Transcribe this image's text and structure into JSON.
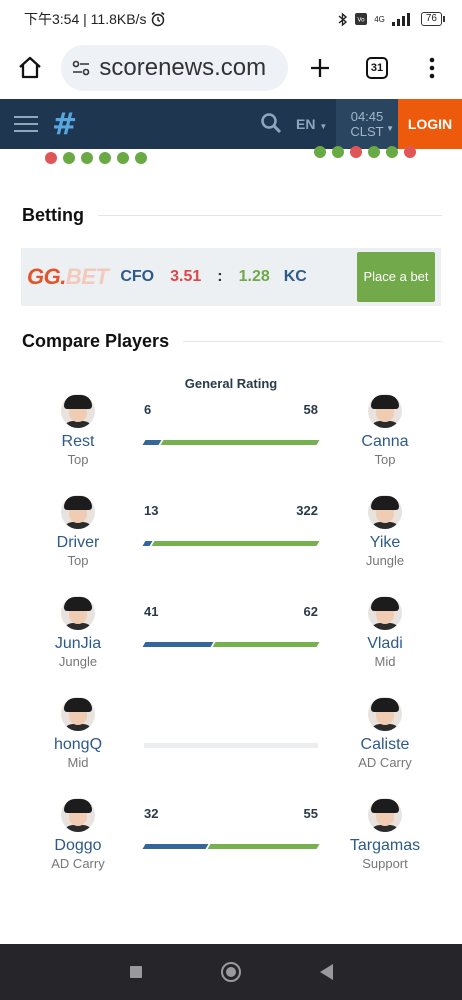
{
  "status_bar": {
    "time_speed": "下午3:54 | 11.8KB/s",
    "network": "4G",
    "battery": "76"
  },
  "browser": {
    "url": "scorenews.com",
    "tab_count": "31"
  },
  "site_header": {
    "language": "EN",
    "clock_time": "04:45",
    "clock_zone": "CLST",
    "login_label": "LOGIN"
  },
  "form_dots": {
    "left": [
      "red",
      "green",
      "green",
      "green",
      "green",
      "green"
    ],
    "right": [
      "green",
      "green",
      "red",
      "green",
      "green",
      "red"
    ],
    "colors": {
      "red": "#e05555",
      "green": "#6aaa45"
    }
  },
  "betting": {
    "title": "Betting",
    "bookmaker": {
      "part1": "GG.",
      "part2": "BET"
    },
    "team_a": "CFO",
    "odd_a": "3.51",
    "separator": ":",
    "odd_b": "1.28",
    "team_b": "KC",
    "button_label": "Place a bet"
  },
  "compare": {
    "title": "Compare Players",
    "metric_title": "General Rating",
    "pairs": [
      {
        "left": {
          "name": "Rest",
          "role": "Top"
        },
        "right": {
          "name": "Canna",
          "role": "Top"
        },
        "left_value": "6",
        "right_value": "58"
      },
      {
        "left": {
          "name": "Driver",
          "role": "Top"
        },
        "right": {
          "name": "Yike",
          "role": "Jungle"
        },
        "left_value": "13",
        "right_value": "322"
      },
      {
        "left": {
          "name": "JunJia",
          "role": "Jungle"
        },
        "right": {
          "name": "Vladi",
          "role": "Mid"
        },
        "left_value": "41",
        "right_value": "62"
      },
      {
        "left": {
          "name": "hongQ",
          "role": "Mid"
        },
        "right": {
          "name": "Caliste",
          "role": "AD Carry"
        },
        "left_value": "",
        "right_value": ""
      },
      {
        "left": {
          "name": "Doggo",
          "role": "AD Carry"
        },
        "right": {
          "name": "Targamas",
          "role": "Support"
        },
        "left_value": "32",
        "right_value": "55"
      }
    ]
  },
  "colors": {
    "header_bg": "#1e3650",
    "login_bg": "#ee5a0c",
    "bar_left": "#35669a",
    "bar_right": "#77b04f",
    "place_bet_bg": "#72aa4b"
  }
}
